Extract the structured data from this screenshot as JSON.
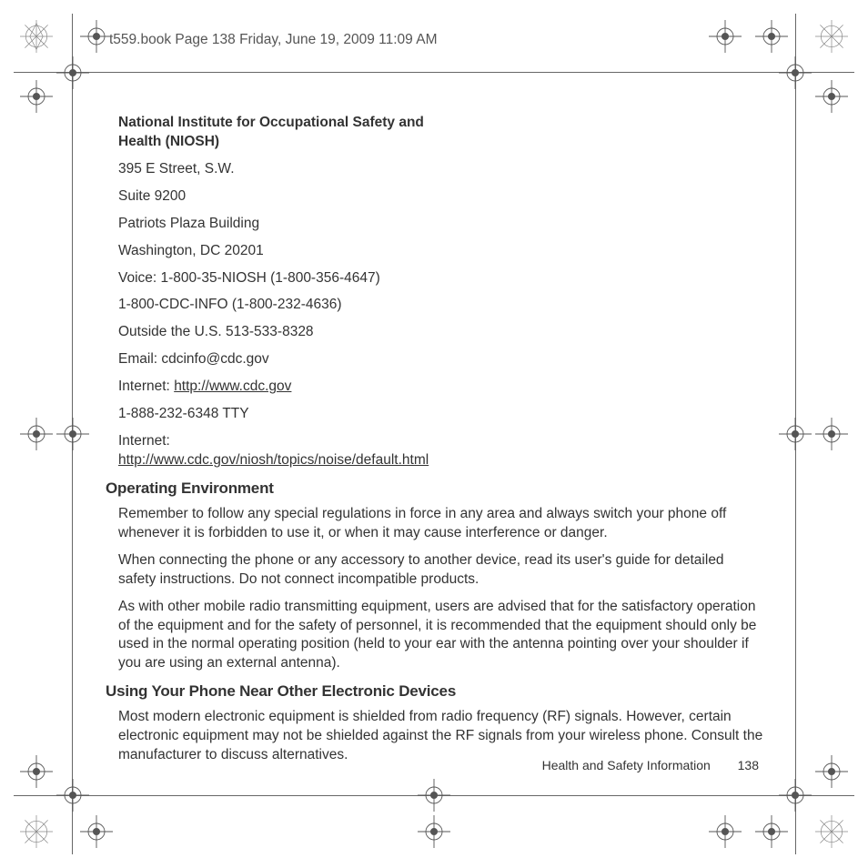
{
  "header": "t559.book  Page 138  Friday, June 19, 2009  11:09 AM",
  "niosh": {
    "title": "National Institute for Occupational Safety and Health (NIOSH)",
    "lines": [
      "395 E Street, S.W.",
      "Suite 9200",
      "Patriots Plaza Building",
      "Washington, DC 20201",
      "Voice: 1-800-35-NIOSH (1-800-356-4647)",
      "1-800-CDC-INFO (1-800-232-4636)",
      "Outside the U.S. 513-533-8328",
      "Email: cdcinfo@cdc.gov"
    ],
    "internet1_label": "Internet: ",
    "internet1_link": "http://www.cdc.gov",
    "tty": "1-888-232-6348 TTY",
    "internet2_label": "Internet: ",
    "internet2_link": "http://www.cdc.gov/niosh/topics/noise/default.html"
  },
  "section1": {
    "heading": "Operating Environment",
    "p1": "Remember to follow any special regulations in force in any area and always switch your phone off whenever it is forbidden to use it, or when it may cause interference or danger.",
    "p2": "When connecting the phone or any accessory to another device, read its user's guide for detailed safety instructions. Do not connect incompatible products.",
    "p3": "As with other mobile radio transmitting equipment, users are advised that for the satisfactory operation of the equipment and for the safety of personnel, it is recommended that the equipment should only be used in the normal operating position (held to your ear with the antenna pointing over your shoulder if you are using an external antenna)."
  },
  "section2": {
    "heading": "Using Your Phone Near Other Electronic Devices",
    "p1": "Most modern electronic equipment is shielded from radio frequency (RF) signals. However, certain electronic equipment may not be shielded against the RF signals from your wireless phone. Consult the manufacturer to discuss alternatives."
  },
  "footer": {
    "section": "Health and Safety Information",
    "page": "138"
  }
}
